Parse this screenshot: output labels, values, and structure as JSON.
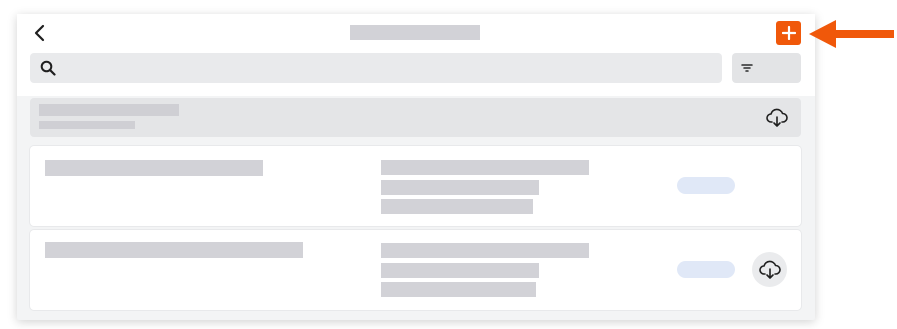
{
  "header": {
    "back_icon": "chevron-left-icon",
    "add_icon": "plus-icon"
  },
  "toolbar": {
    "search_icon": "search-icon",
    "filter_icon": "filter-icon"
  },
  "group": {
    "download_icon": "cloud-download-icon"
  },
  "rows": [
    {
      "status_pill": "",
      "has_download_button": false
    },
    {
      "status_pill": "",
      "has_download_button": true,
      "download_icon": "cloud-download-icon"
    }
  ],
  "annotation": {
    "icon": "arrow-left-icon",
    "color": "#f0580a"
  },
  "colors": {
    "accent": "#f0580a",
    "placeholder": "#d2d2d7",
    "pill": "#e0e8f7",
    "panel_background": "#f3f4f5"
  }
}
